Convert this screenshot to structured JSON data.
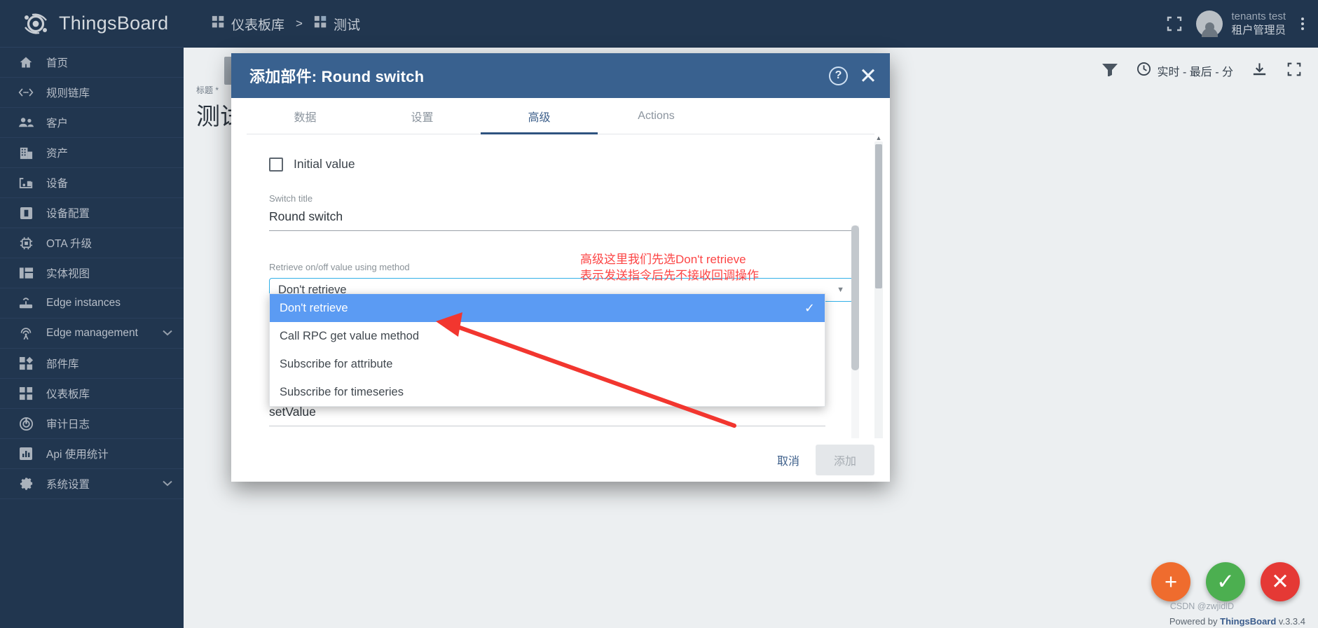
{
  "app": {
    "brand": "ThingsBoard"
  },
  "sidebar": {
    "items": [
      {
        "label": "首页",
        "icon": "home-icon"
      },
      {
        "label": "规则链库",
        "icon": "rule-chain-icon"
      },
      {
        "label": "客户",
        "icon": "customers-icon"
      },
      {
        "label": "资产",
        "icon": "assets-icon"
      },
      {
        "label": "设备",
        "icon": "devices-icon"
      },
      {
        "label": "设备配置",
        "icon": "device-profile-icon"
      },
      {
        "label": "OTA 升级",
        "icon": "ota-update-icon"
      },
      {
        "label": "实体视图",
        "icon": "entity-view-icon"
      },
      {
        "label": "Edge instances",
        "icon": "edge-instance-icon"
      },
      {
        "label": "Edge management",
        "icon": "edge-management-icon",
        "expandable": true
      },
      {
        "label": "部件库",
        "icon": "widget-library-icon"
      },
      {
        "label": "仪表板库",
        "icon": "dashboard-library-icon"
      },
      {
        "label": "审计日志",
        "icon": "audit-log-icon"
      },
      {
        "label": "Api 使用统计",
        "icon": "api-usage-icon"
      },
      {
        "label": "系统设置",
        "icon": "system-settings-icon",
        "expandable": true
      }
    ]
  },
  "topbar": {
    "breadcrumb": [
      {
        "label": "仪表板库",
        "icon": "dashboard-library-icon"
      },
      {
        "label": "测试",
        "icon": "dashboard-icon"
      }
    ],
    "separator": ">",
    "fullscreen_icon": "fullscreen-icon",
    "user": {
      "name": "tenants test",
      "role": "租户管理员",
      "avatar_icon": "avatar-icon"
    },
    "menu_icon": "kebab-menu-icon"
  },
  "dashboard": {
    "title_label": "标题 *",
    "title_value": "测试",
    "time_range": "实时 - 最后 - 分",
    "clock_icon": "clock-icon",
    "filter_icon": "filter-icon",
    "download_icon": "download-icon",
    "expand_icon": "expand-icon",
    "back_icon": "back-arrow-icon",
    "fabs": [
      {
        "name": "add-fab",
        "glyph": "+",
        "color": "#ef6c2e"
      },
      {
        "name": "apply-fab",
        "glyph": "✓",
        "color": "#4caf50"
      },
      {
        "name": "cancel-fab",
        "glyph": "✕",
        "color": "#e53935"
      }
    ],
    "powered_prefix": "Powered by ",
    "powered_link": "ThingsBoard",
    "powered_version": " v.3.3.4",
    "watermark": "CSDN @zwjidlD"
  },
  "dialog": {
    "title": "添加部件: Round switch",
    "help_icon": "help-icon",
    "close_icon": "close-icon",
    "tabs": [
      {
        "label": "数据",
        "active": false
      },
      {
        "label": "设置",
        "active": false
      },
      {
        "label": "高级",
        "active": true
      },
      {
        "label": "Actions",
        "active": false
      }
    ],
    "form": {
      "initial_value_label": "Initial value",
      "initial_value_checked": false,
      "switch_title_label": "Switch title",
      "switch_title_value": "Round switch",
      "retrieve_label": "Retrieve on/off value using method",
      "retrieve_value": "Don't retrieve",
      "dropdown_arrow_icon": "chevron-down-icon",
      "options": [
        {
          "label": "Don't retrieve",
          "selected": true
        },
        {
          "label": "Call RPC get value method",
          "selected": false
        },
        {
          "label": "Subscribe for attribute",
          "selected": false
        },
        {
          "label": "Subscribe for timeseries",
          "selected": false
        }
      ],
      "check_glyph": "✓",
      "set_value_field": "setValue"
    },
    "footer": {
      "cancel_label": "取消",
      "add_label": "添加"
    }
  },
  "annotation": {
    "line1": "高级这里我们先选Don't retrieve",
    "line2": "表示发送指令后先不接收回调操作",
    "color": "#fc4545",
    "arrow_icon": "red-arrow-icon"
  }
}
